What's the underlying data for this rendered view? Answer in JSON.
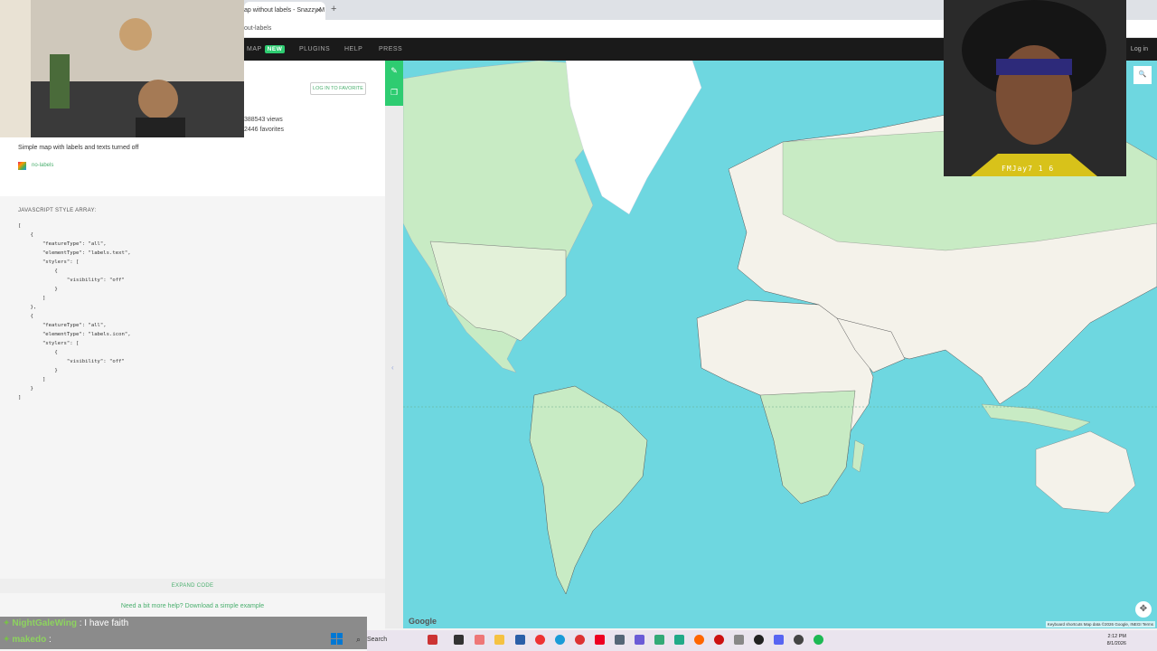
{
  "browser": {
    "tab_title": "ap without labels - Snazzy M",
    "tab_close": "✕",
    "new_tab": "+",
    "url": "out-labels"
  },
  "site_nav": {
    "items": [
      "MAP",
      "PLUGINS",
      "HELP",
      "PRESS"
    ],
    "new_badge": "NEW",
    "login": "Log in"
  },
  "style_info": {
    "favorite_button": "LOG IN TO FAVORITE",
    "views": "388543 views",
    "favorites": "2446 favorites",
    "description": "Simple map with labels and texts turned off",
    "tag": "no-labels",
    "code_heading": "JAVASCRIPT STYLE ARRAY:",
    "code_lines": [
      "[",
      "    {",
      "        \"featureType\": \"all\",",
      "        \"elementType\": \"labels.text\",",
      "        \"stylers\": [",
      "            {",
      "                \"visibility\": \"off\"",
      "            }",
      "        ]",
      "    },",
      "    {",
      "        \"featureType\": \"all\",",
      "        \"elementType\": \"labels.icon\",",
      "        \"stylers\": [",
      "            {",
      "                \"visibility\": \"off\"",
      "            }",
      "        ]",
      "    }",
      "]"
    ],
    "expand_code": "EXPAND CODE",
    "help_text": "Need a bit more help? Download a simple example"
  },
  "map": {
    "google_logo": "Google",
    "attribution": "Keyboard shortcuts   Map data ©2026 Google, INEGI   Terms",
    "water_color": "#6ed7e0",
    "land_color": "#f4f2ea",
    "vegetation_color": "#c8ebc4",
    "ice_color": "#ffffff"
  },
  "stream": {
    "avatar_name": "FMJay7 1 6",
    "chat": [
      {
        "user": "NightGaleWing",
        "message": ": I have faith"
      },
      {
        "user": "makedo",
        "message": ":"
      }
    ]
  },
  "taskbar": {
    "search_placeholder": "Search",
    "time": "2:12 PM",
    "date": "8/1/2026"
  }
}
